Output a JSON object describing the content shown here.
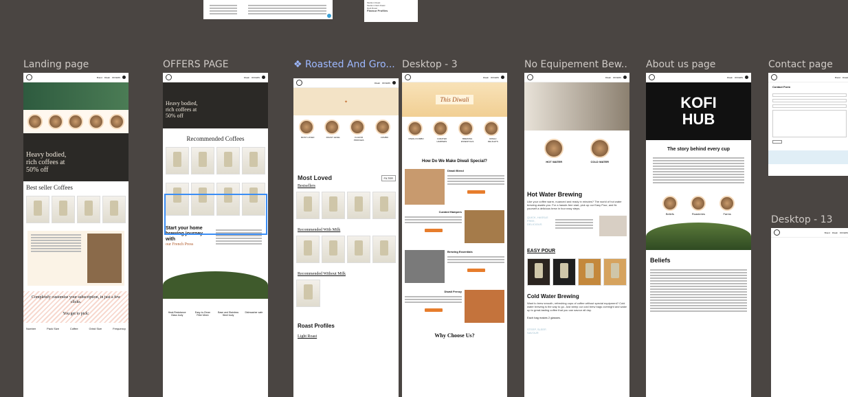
{
  "frames": [
    {
      "label": "Landing page"
    },
    {
      "label": "OFFERS PAGE"
    },
    {
      "label": "❖ Roasted And Gro..."
    },
    {
      "label": "Desktop - 3"
    },
    {
      "label": "No Equipement Bew..."
    },
    {
      "label": "About us page"
    },
    {
      "label": "Contact page"
    },
    {
      "label": "Desktop - 13"
    }
  ],
  "top_card": {
    "item1": "Medium Roast",
    "item2": "Medium Dark Roast",
    "item3": "Dark Roast",
    "item4": "Flavour Profiles"
  },
  "nav": {
    "brand": "KOFI HUB",
    "links": [
      "Brand",
      "Diwali",
      "OFFERS",
      "EQUIPMENT",
      "ABOUT US"
    ]
  },
  "landing": {
    "hero_text": "Heavy bodied, rich coffees at 50% off",
    "bestseller": "Best seller Coffees",
    "customise": "Completely customise your subscription, in just a few clicks.",
    "pick": "You get to pick:",
    "options": [
      "Number",
      "Pack Size",
      "Coffee",
      "Grind Size",
      "Frequency"
    ]
  },
  "offers": {
    "hero": "Heavy bodied, rich coffees at 50% off",
    "recommended": "Recommended Coffees",
    "start": "Start your home brewing journey with",
    "our": "our French Press",
    "features": [
      "Heat-Resistance Glass body",
      "Easy-to-Clean Filter Mesh",
      "Base and Stainless Steel body",
      "Dishwasher safe"
    ]
  },
  "roasted": {
    "cats": [
      "MOST LOVED",
      "ROAST LEVEL",
      "FLAVOR PROFILES",
      "COMBO"
    ],
    "most_loved": "Most Loved",
    "filter": "FILTER",
    "bestsellers": "Bestsellers",
    "rec_milk": "Recommended With Milk",
    "rec_without": "Recommended Without Milk",
    "roast_profiles": "Roast Profiles",
    "light_roast": "Light Roast"
  },
  "desktop3": {
    "this_diwali": "This Diwali",
    "cats": [
      "DIWALI KOMBO",
      "CURATED HAMPERS",
      "BREWING ESSENTIALS",
      "DIWALI DELIGHTS"
    ],
    "question": "How Do We Make Diwali Special?",
    "blocks": [
      "Diwali Blend",
      "Curated Hampers",
      "Brewing Essentials",
      "Diwali Frenzy"
    ],
    "why": "Why Choose Us?"
  },
  "noequip": {
    "hot": "HOT WATER",
    "cold": "COLD WATER",
    "hot_brewing": "Hot Water Brewing",
    "hot_desc": "Like your coffee warm, nuanced and ready in minutes? The world of hot water brewing awaits you. For a hassle-free start, pick up our Easy Pour, and fix yourself a delicious brew in four easy steps.",
    "quick": "QUICK, HASSLE FREE, DELICIOUS",
    "easy_pour": "EASY POUR",
    "cold_brewing": "Cold Water Brewing",
    "cold_desc": "Want to brew smooth, refreshing cups of coffee without special equipment? Cold water brewing is the way to go. Just steep our cold brew bags overnight and wake up to great-tasting coffee that you can savour all day.",
    "bags": "Each bag makes 2 glasses.",
    "steep": "STEEP, SLEEP, SAVOUR"
  },
  "about": {
    "brand_big": "KOFI HUB",
    "story": "The story behind every cup",
    "icons": [
      "Beliefs",
      "Roasteries",
      "Farms"
    ],
    "beliefs": "Beliefs"
  },
  "contact": {
    "heading": "Contact Form"
  }
}
